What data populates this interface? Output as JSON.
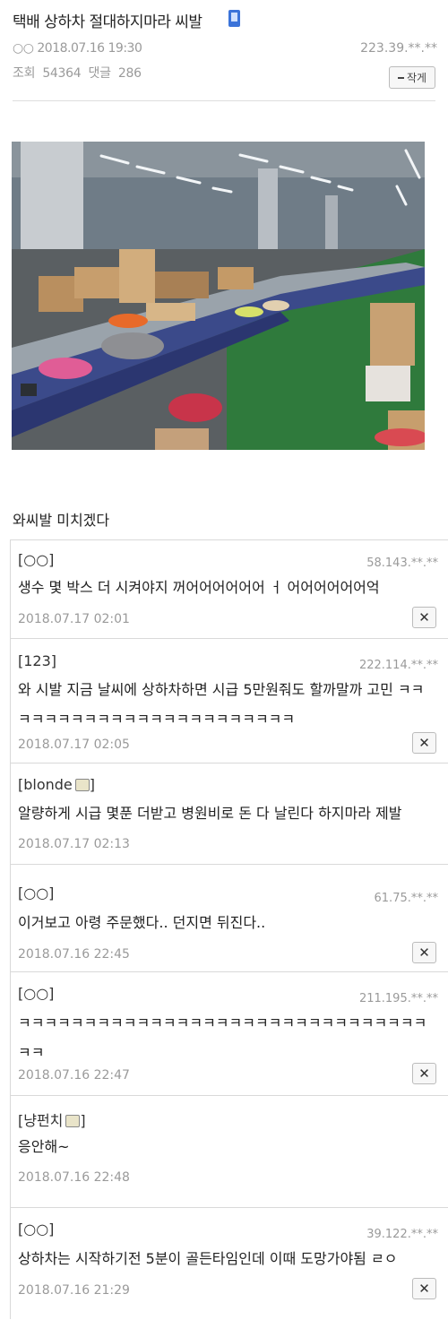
{
  "post": {
    "title": "택배 상하차 절대하지마라 씨발",
    "icon": "mobile-icon",
    "author": "○○",
    "datetime": "2018.07.16 19:30",
    "ip": "223.39.**.**",
    "views_label": "조회",
    "views": "54364",
    "comments_label": "댓글",
    "comments_count": "286",
    "report_label": "작게",
    "body": "와씨발 미치겠다"
  },
  "comments": [
    {
      "nick": "[○○]",
      "ip": "58.143.**.**",
      "text": "생수 몇 박스 더 시켜야지 꺼어어어어어어 ㅓ 어어어어어어억",
      "date": "2018.07.17 02:01",
      "has_delete": true
    },
    {
      "nick": "[123]",
      "ip": "222.114.**.**",
      "text": "와 시발 지금 날씨에 상하차하면 시급 5만원줘도 할까말까 고민 ㅋㅋㅋㅋㅋㅋㅋㅋㅋㅋㅋㅋㅋㅋㅋㅋㅋㅋㅋㅋㅋㅋㅋ",
      "date": "2018.07.17 02:05",
      "has_delete": true
    },
    {
      "nick": "[blonde",
      "nick_suffix": "]",
      "text": "알량하게 시급 몇푼 더받고 병원비로 돈 다 날린다 하지마라 제발",
      "date": "2018.07.17 02:13",
      "has_delete": false
    },
    {
      "nick": "[○○]",
      "ip": "61.75.**.**",
      "text": "이거보고 아령 주문했다.. 던지면 뒤진다..",
      "date": "2018.07.16 22:45",
      "has_delete": true
    },
    {
      "nick": "[○○]",
      "ip": "211.195.**.**",
      "text": "ㅋㅋㅋㅋㅋㅋㅋㅋㅋㅋㅋㅋㅋㅋㅋㅋㅋㅋㅋㅋㅋㅋㅋㅋㅋㅋㅋㅋㅋㅋㅋㅋㅋ",
      "date": "2018.07.16 22:47",
      "has_delete": true
    },
    {
      "nick": "[냥펀치",
      "nick_suffix": "]",
      "text": "응안해~",
      "date": "2018.07.16 22:48",
      "has_delete": false
    },
    {
      "nick": "[○○]",
      "ip": "39.122.**.**",
      "text": "상하차는 시작하기전 5분이 골든타임인데 이때 도망가야됨 ㄹㅇ",
      "date": "2018.07.16 21:29",
      "has_delete": true
    }
  ],
  "icons": {
    "delete": "close-icon",
    "badge": "badge-icon"
  },
  "colors": {
    "meta": "#9a9a9a",
    "conveyor": "#3b4a8a",
    "floor": "#2f7a3c"
  }
}
